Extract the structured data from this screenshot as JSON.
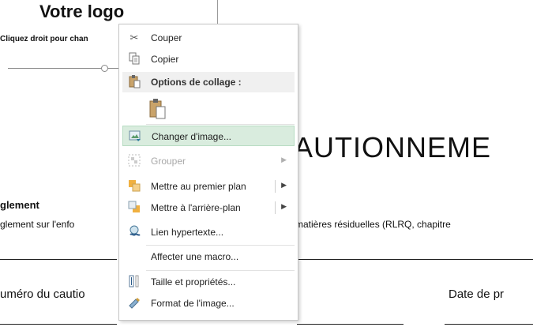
{
  "document": {
    "logo_title": "Votre logo",
    "logo_hint": "Cliquez droit pour chan",
    "big_title": "AUTIONNEME",
    "section_heading": "glement",
    "regulation_left": "glement sur l'enfo",
    "regulation_right": "matières résiduelles (RLRQ, chapitre",
    "field_left": "uméro du cautio",
    "field_right": "Date de pr"
  },
  "context_menu": {
    "cut": "Couper",
    "copy": "Copier",
    "paste_options": "Options de collage :",
    "change_image": "Changer d'image...",
    "group": "Grouper",
    "bring_front": "Mettre au premier plan",
    "send_back": "Mettre à l'arrière-plan",
    "hyperlink": "Lien hypertexte...",
    "assign_macro": "Affecter une macro...",
    "size_properties": "Taille et propriétés...",
    "format_image": "Format de l'image..."
  },
  "icons": {
    "cut": "scissors-icon",
    "copy": "copy-icon",
    "paste": "clipboard-icon",
    "change_image": "change-picture-icon",
    "group": "group-icon",
    "bring_front": "bring-forward-icon",
    "send_back": "send-backward-icon",
    "hyperlink": "link-icon",
    "size_properties": "size-icon",
    "format_image": "format-picture-icon"
  },
  "colors": {
    "highlight": "#d9ecde",
    "highlight_border": "#b7dcc2",
    "disabled_text": "#a8a8a8"
  }
}
